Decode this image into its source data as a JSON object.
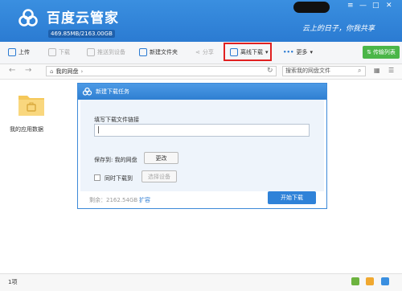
{
  "app": {
    "title": "百度云管家",
    "quota": "469.85MB/2163.00GB",
    "slogan": "云上的日子，你我共享"
  },
  "window_controls": {
    "minimize": "—",
    "maximize": "□",
    "close": "✕"
  },
  "toolbar": {
    "upload": "上传",
    "download": "下载",
    "push_device": "推送到设备",
    "new_folder": "新建文件夹",
    "share": "分享",
    "offline_download": "离线下载",
    "more": "更多",
    "transfer_list": "传输列表"
  },
  "nav": {
    "back": "←",
    "forward": "→",
    "path": "我的网盘",
    "search_placeholder": "搜索我的网盘文件"
  },
  "files": [
    {
      "name": "我的应用数据",
      "icon": "folder-icon"
    }
  ],
  "dialog": {
    "title": "新建下载任务",
    "link_label": "填写下载文件链接",
    "link_value": "|",
    "save_to_label": "保存到: 我的网盘",
    "change_button": "更改",
    "also_download_label": "同时下载到",
    "select_device_button": "选择设备",
    "remaining": "剩余：2162.54GB",
    "expand": "扩容",
    "start_button": "开始下载"
  },
  "status": {
    "count": "1项"
  },
  "colors": {
    "header_blue": "#2b7bd2",
    "share_green": "#4bb648",
    "highlight_red": "#e02020",
    "start_blue": "#2f82d8"
  }
}
